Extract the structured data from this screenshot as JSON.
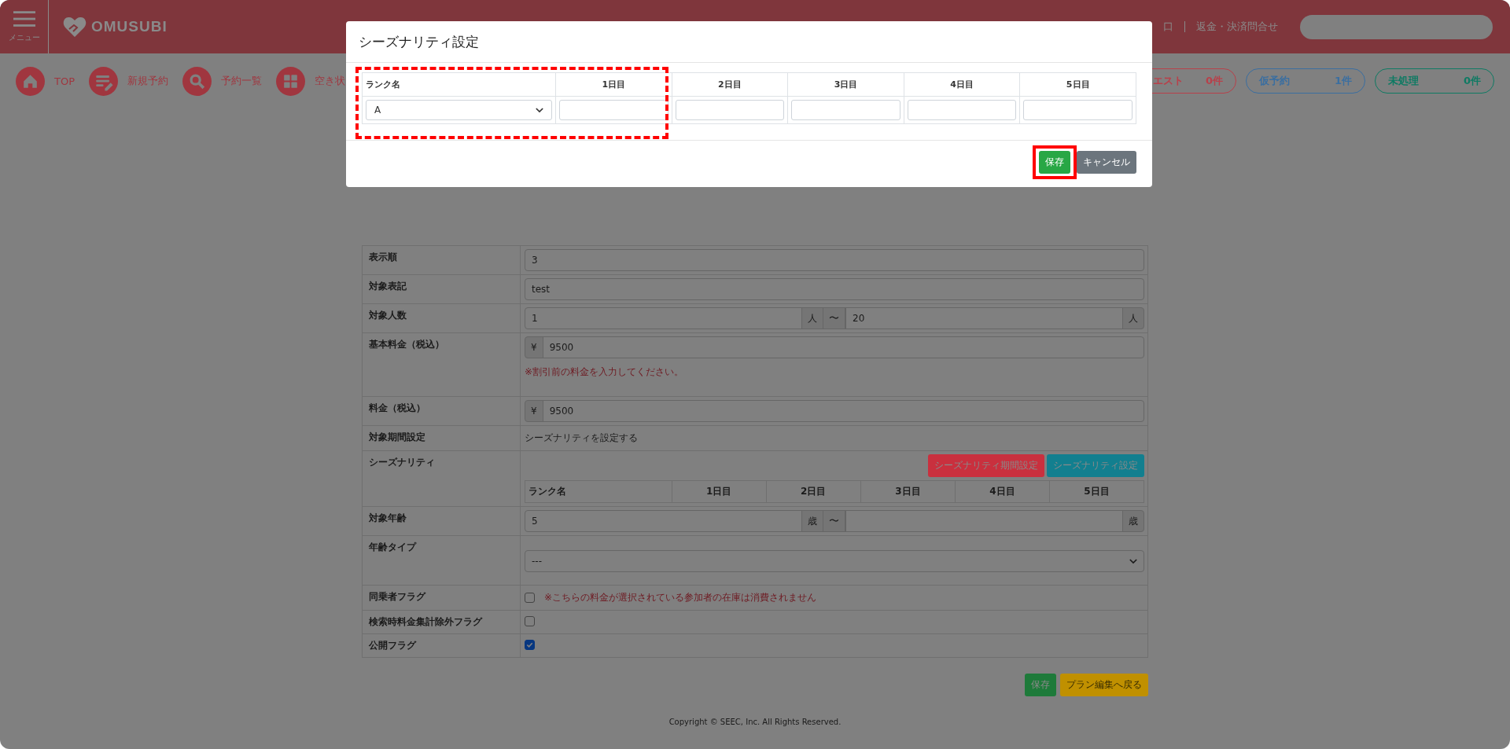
{
  "header": {
    "menu_label": "メニュー",
    "logo": "OMUSUBI",
    "links": [
      "口",
      "返金・決済問合せ"
    ]
  },
  "nav": {
    "items": [
      {
        "label": "TOP"
      },
      {
        "label": "新規予約"
      },
      {
        "label": "予約一覧"
      },
      {
        "label": "空き状"
      }
    ],
    "pills": [
      {
        "label": "エスト",
        "count": "0件",
        "color": "#b8404a"
      },
      {
        "label": "仮予約",
        "count": "1件",
        "color": "#3a6ea0"
      },
      {
        "label": "未処理",
        "count": "0件",
        "color": "#0e7a63"
      }
    ]
  },
  "form": {
    "rows": [
      {
        "kind": "text",
        "label": "表示順",
        "value": "3"
      },
      {
        "kind": "text",
        "label": "対象表記",
        "value": "test"
      },
      {
        "kind": "range",
        "label": "対象人数",
        "from": "1",
        "unit_from": "人",
        "tilde": "〜",
        "to": "20",
        "unit_to": "人"
      },
      {
        "kind": "money",
        "label": "基本料金（税込）",
        "prefix": "¥",
        "value": "9500",
        "note": "※割引前の料金を入力してください。"
      },
      {
        "kind": "money",
        "label": "料金（税込）",
        "prefix": "¥",
        "value": "9500"
      },
      {
        "kind": "static",
        "label": "対象期間設定",
        "text": "シーズナリティを設定する"
      },
      {
        "kind": "seasonality",
        "label": "シーズナリティ",
        "buttons": [
          {
            "label": "シーズナリティ期間設定",
            "kind": "danger"
          },
          {
            "label": "シーズナリティ設定",
            "kind": "info"
          }
        ],
        "columns": [
          "ランク名",
          "1日目",
          "2日目",
          "3日目",
          "4日目",
          "5日目"
        ]
      },
      {
        "kind": "range",
        "label": "対象年齢",
        "from": "5",
        "unit_from": "歳",
        "tilde": "〜",
        "unit_to": "歳"
      },
      {
        "kind": "select",
        "label": "年齢タイプ",
        "value": "---"
      },
      {
        "kind": "checkbox",
        "label": "同乗者フラグ",
        "checked": false,
        "note": "※こちらの料金が選択されている参加者の在庫は消費されません"
      },
      {
        "kind": "checkbox",
        "label": "検索時料金集計除外フラグ",
        "checked": false
      },
      {
        "kind": "checkbox",
        "label": "公開フラグ",
        "checked": true
      }
    ],
    "actions": [
      {
        "label": "保存",
        "kind": "success"
      },
      {
        "label": "プラン編集へ戻る",
        "kind": "warning"
      }
    ]
  },
  "footer": {
    "copyright": "Copyright © SEEC, Inc. All Rights Reserved."
  },
  "modal": {
    "title": "シーズナリティ設定",
    "columns": [
      "ランク名",
      "1日目",
      "2日目",
      "3日目",
      "4日目",
      "5日目"
    ],
    "rank_value": "A",
    "buttons": [
      {
        "label": "保存",
        "kind": "success"
      },
      {
        "label": "キャンセル",
        "kind": "secondary"
      }
    ]
  }
}
